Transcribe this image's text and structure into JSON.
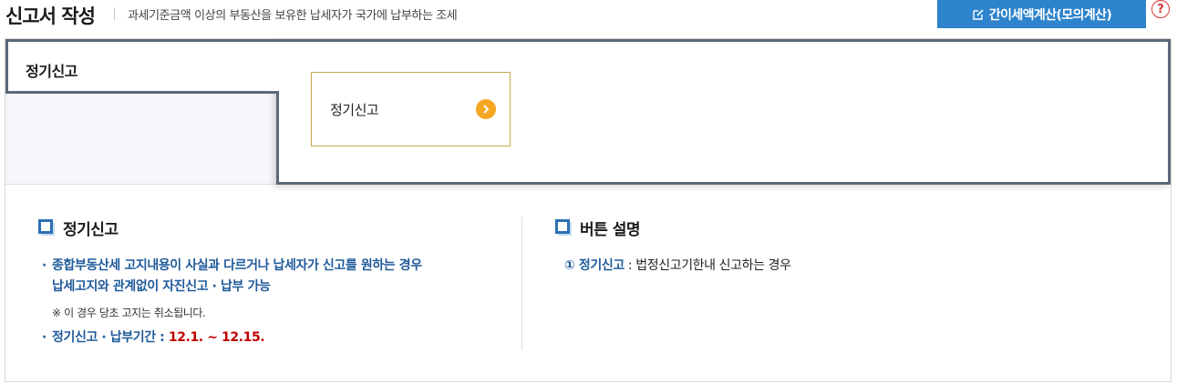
{
  "header": {
    "title": "신고서 작성",
    "subtitle": "과세기준금액 이상의 부동산을 보유한 납세자가 국가에 납부하는 조세",
    "calc_button": "간이세액계산(모의계산)",
    "help_symbol": "?"
  },
  "tab": {
    "label": "정기신고",
    "option_label": "정기신고"
  },
  "left_section": {
    "title": "정기신고",
    "bullet1_line1": "종합부동산세 고지내용이 사실과 다르거나 납세자가 신고를 원하는 경우",
    "bullet1_line2": "납세고지와 관계없이 자진신고 · 납부 가능",
    "note": "※ 이 경우 당초 고지는 취소됩니다.",
    "bullet2_label": "정기신고 · 납부기간 : ",
    "bullet2_period": "12.1. ~ 12.15."
  },
  "right_section": {
    "title": "버튼 설명",
    "item_label": "① 정기신고",
    "item_desc": " : 법정신고기한내 신고하는 경우"
  },
  "colors": {
    "button_blue": "#2d83cc",
    "tab_border": "#5b6878",
    "card_border": "#c9a64a",
    "arrow_orange": "#f5a623",
    "text_blue": "#1f5a9a",
    "period_red": "#c00000"
  }
}
